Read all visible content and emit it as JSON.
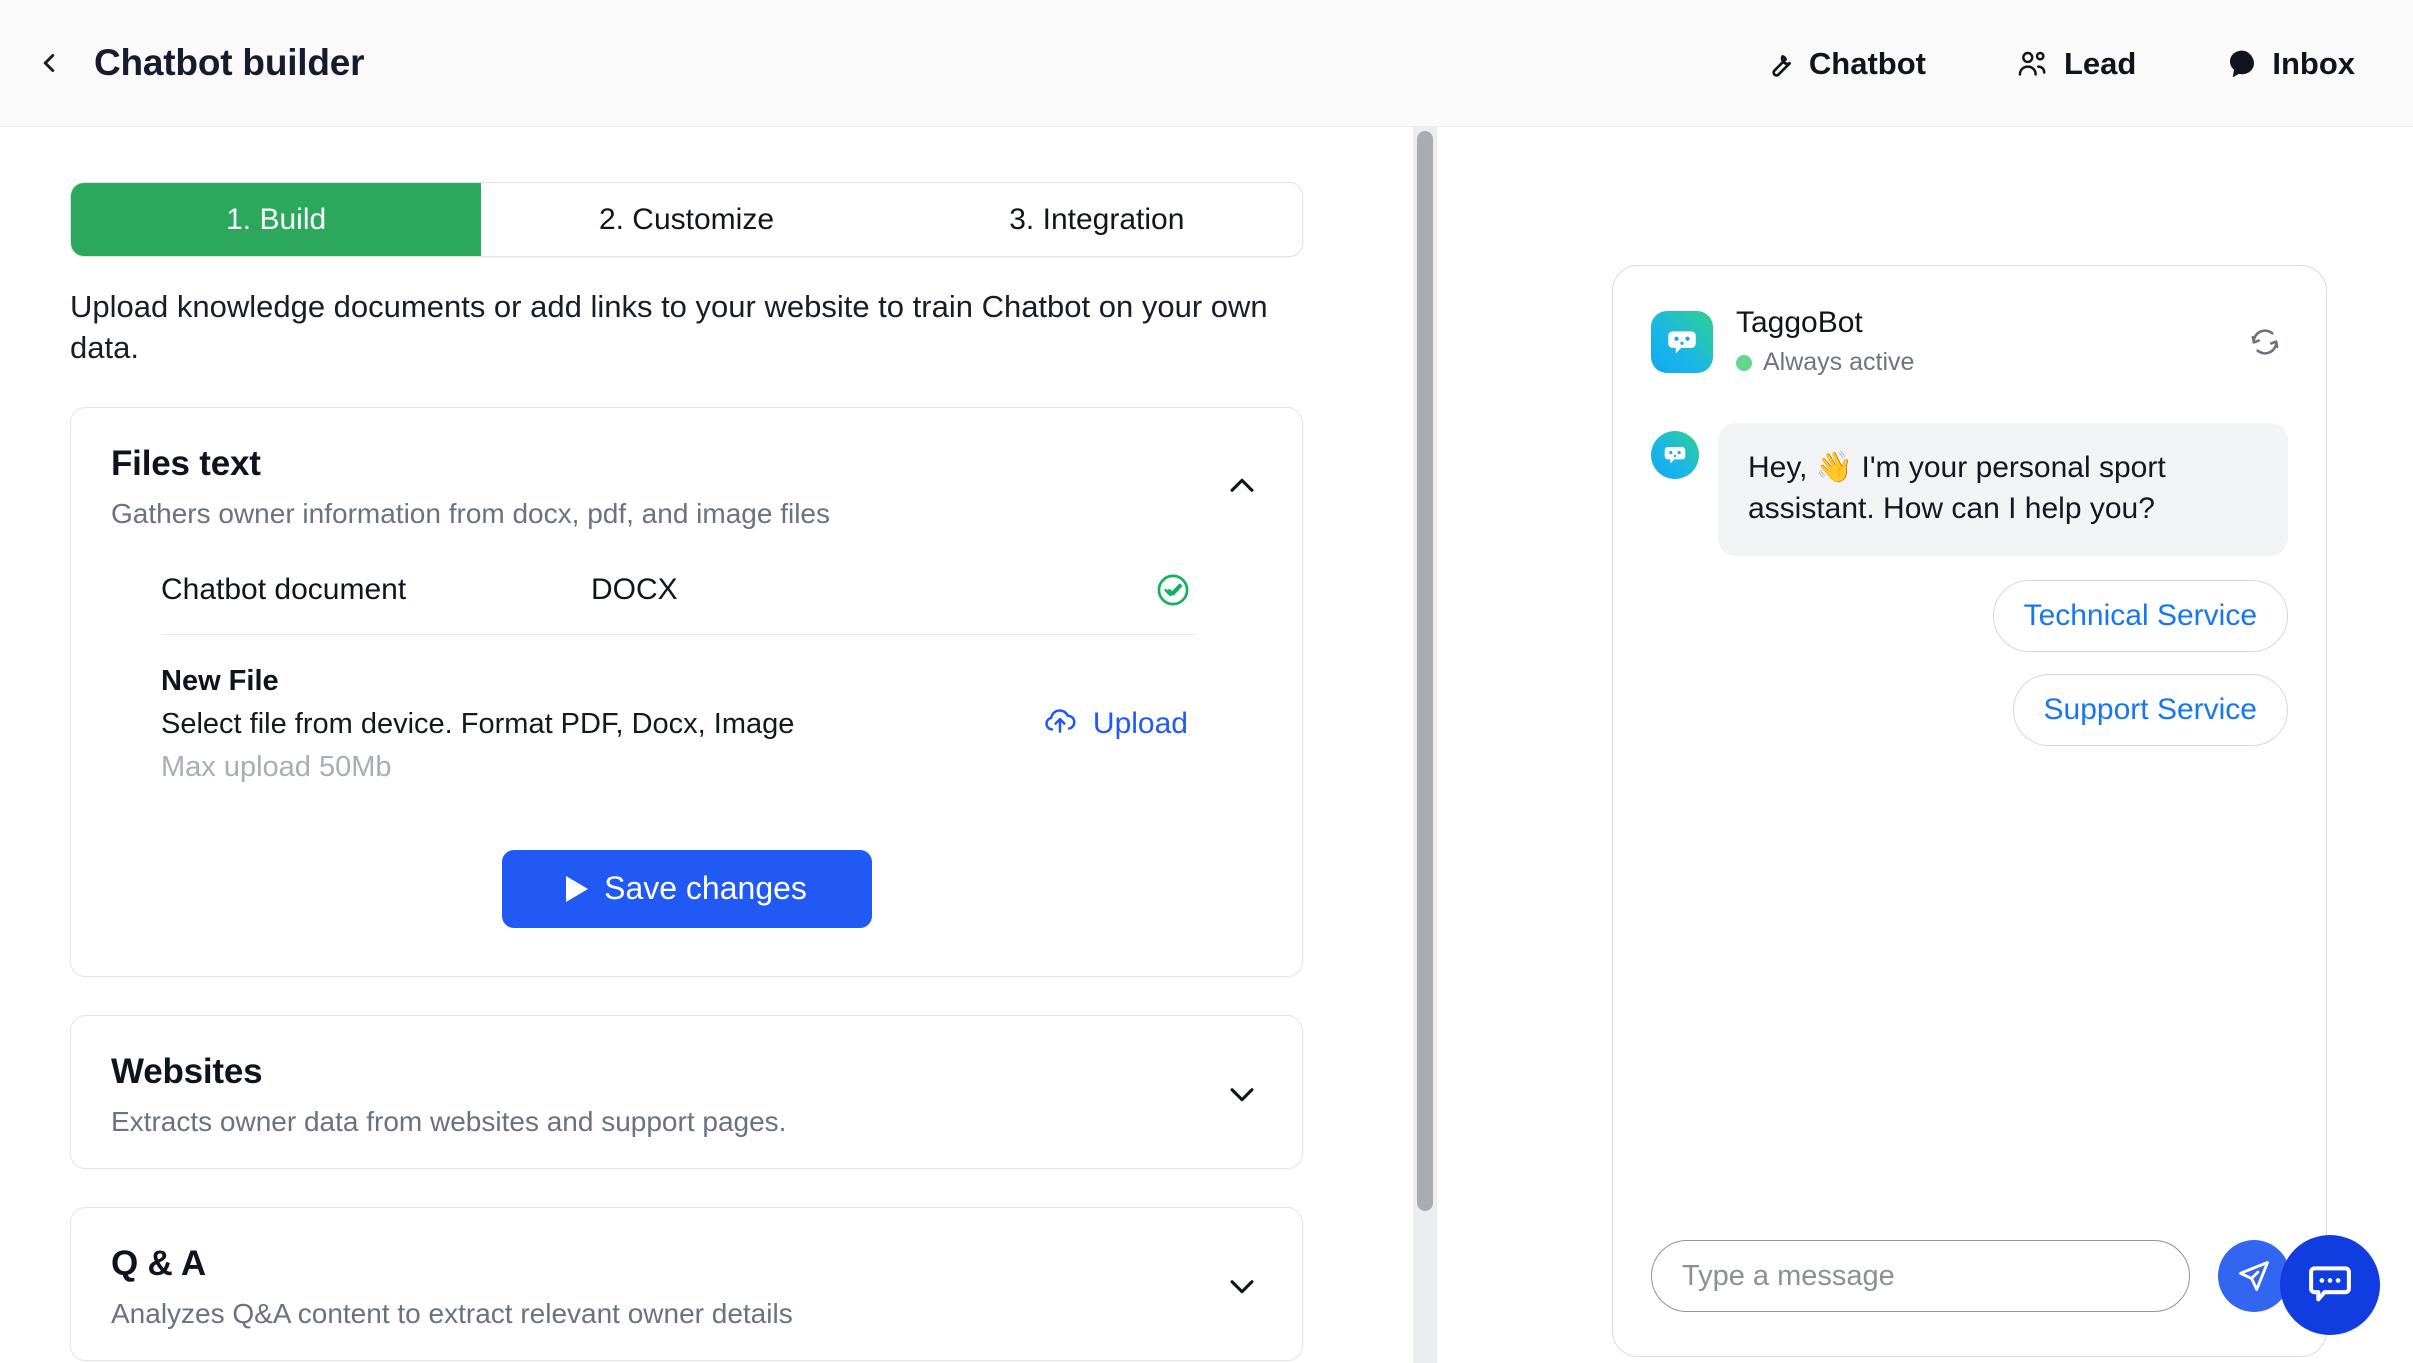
{
  "header": {
    "title": "Chatbot builder",
    "back_icon": "chevron-left-icon",
    "nav": [
      {
        "label": "Chatbot",
        "icon": "wrench-icon"
      },
      {
        "label": "Lead",
        "icon": "users-icon"
      },
      {
        "label": "Inbox",
        "icon": "chat-bubble-icon"
      }
    ]
  },
  "builder": {
    "tabs": [
      {
        "label": "1. Build",
        "active": true
      },
      {
        "label": "2. Customize",
        "active": false
      },
      {
        "label": "3. Integration",
        "active": false
      }
    ],
    "intro": "Upload knowledge documents or add links to your website to train Chatbot on your own data.",
    "cards": [
      {
        "title": "Files text",
        "subtitle": "Gathers owner information from docx, pdf, and image files",
        "chevron": "chevron-up-icon",
        "expanded": true
      },
      {
        "title": "Websites",
        "subtitle": "Extracts owner data from websites and support pages.",
        "chevron": "chevron-down-icon",
        "expanded": false
      },
      {
        "title": "Q & A",
        "subtitle": "Analyzes Q&A content to extract relevant owner details",
        "chevron": "chevron-down-icon",
        "expanded": false
      }
    ],
    "files": [
      {
        "name": "Chatbot document",
        "type": "DOCX",
        "status_icon": "check-circle-icon"
      }
    ],
    "new_file": {
      "title": "New File",
      "description": "Select file from device. Format PDF, Docx, Image",
      "max": "Max upload 50Mb",
      "upload_label": "Upload",
      "upload_icon": "cloud-upload-icon"
    },
    "save_label": "Save changes",
    "save_icon": "play-icon"
  },
  "preview": {
    "bot_name": "TaggoBot",
    "status": "Always active",
    "refresh_icon": "refresh-icon",
    "avatar_icon": "bot-face-icon",
    "messages": [
      {
        "from": "bot",
        "text": "Hey, 👋 I'm your personal sport assistant. How can I help you?"
      }
    ],
    "quick_replies": [
      {
        "label": "Technical Service"
      },
      {
        "label": "Support Service"
      }
    ],
    "input_placeholder": "Type a message",
    "input_value": "",
    "send_icon": "send-icon",
    "fab_icon": "chat-dots-icon"
  },
  "colors": {
    "accent_green": "#2ba85c",
    "accent_blue": "#2159f5",
    "link_blue": "#1777f2",
    "fab_blue": "#113ce0",
    "status_green": "#62d68b"
  }
}
